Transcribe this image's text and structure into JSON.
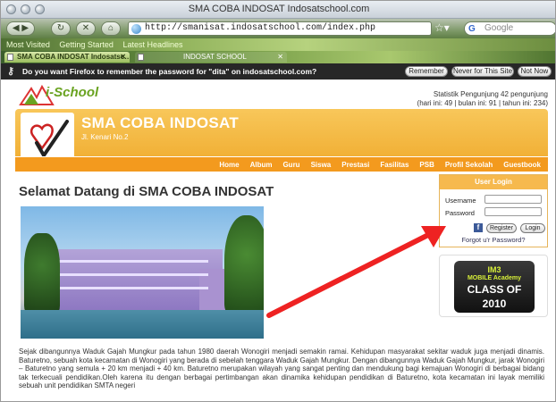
{
  "window": {
    "title": "SMA COBA INDOSAT Indosatschool.com"
  },
  "toolbar": {
    "back_icon": "back-arrow-icon",
    "forward_icon": "forward-arrow-icon",
    "url": "http://smanisat.indosatschool.com/index.php",
    "search_placeholder": "Google"
  },
  "bookmarks": [
    "Most Visited",
    "Getting Started",
    "Latest Headlines"
  ],
  "tabs": [
    {
      "label": "SMA COBA INDOSAT Indosatsc…",
      "active": true
    },
    {
      "label": "INDOSAT SCHOOL",
      "active": false
    }
  ],
  "notification": {
    "message": "Do you want Firefox to remember the password for \"dita\" on indosatschool.com?",
    "buttons": [
      "Remember",
      "Never for This Site",
      "Not Now"
    ]
  },
  "site": {
    "logo_text": "i-School",
    "stats_line1": "Statistik Pengunjung 42 pengunjung",
    "stats_line2": "(hari ini: 49 | bulan ini: 91 | tahun ini: 234)",
    "name": "SMA COBA INDOSAT",
    "address": "Jl. Kenari No.2",
    "menu": [
      "Home",
      "Album",
      "Guru",
      "Siswa",
      "Prestasi",
      "Fasilitas",
      "PSB",
      "Profil Sekolah",
      "Guestbook"
    ]
  },
  "main": {
    "heading": "Selamat Datang di SMA COBA INDOSAT",
    "paragraph": "Sejak dibangunnya Waduk Gajah Mungkur pada tahun 1980 daerah Wonogiri menjadi semakin ramai. Kehidupan masyarakat sekitar waduk juga menjadi dinamis. Baturetno, sebuah kota kecamatan di Wonogiri yang berada di sebelah tenggara Waduk Gajah Mungkur. Dengan dibangunnya Waduk Gajah Mungkur, jarak Wonogiri – Baturetno yang semula + 20 km menjadi + 40 km. Baturetno merupakan wilayah yang sangat penting dan mendukung bagi kemajuan Wonogiri di berbagai bidang tak terkecuali pendidikan.Oleh karena itu dengan berbagai pertimbangan akan dinamika kehidupan pendidikan di Baturetno, kota kecamatan ini layak memiliki sebuah unit pendidikan SMTA negeri"
  },
  "login": {
    "title": "User Login",
    "username_label": "Username",
    "password_label": "Password",
    "register": "Register",
    "login": "Login",
    "forgot": "Forgot u'r Password?"
  },
  "promo": {
    "line1": "IM3",
    "line2": "MOBILE Academy",
    "line3": "CLASS OF 2010"
  }
}
